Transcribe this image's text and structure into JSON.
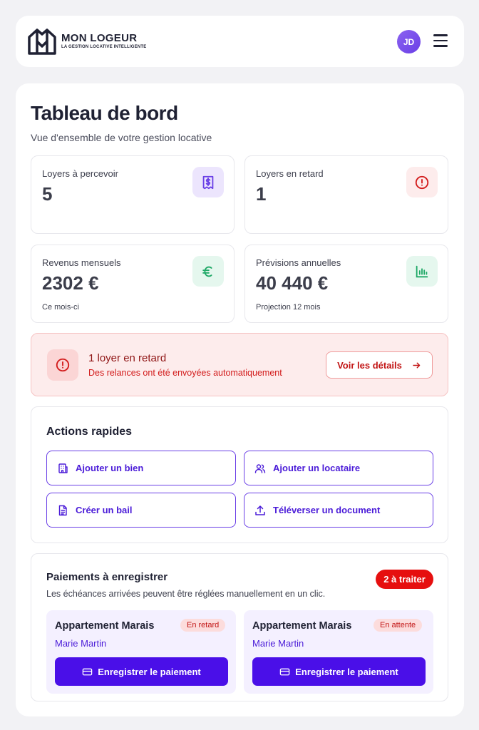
{
  "header": {
    "brand_name": "MON LOGEUR",
    "brand_tagline": "LA GESTION LOCATIVE INTELLIGENTE",
    "avatar_initials": "JD",
    "menu_icon": "hamburger-menu-icon"
  },
  "page": {
    "title": "Tableau de bord",
    "subtitle": "Vue d'ensemble de votre gestion locative"
  },
  "stats": [
    {
      "label": "Loyers à percevoir",
      "value": "5",
      "note": "",
      "icon": "receipt-dollar-icon",
      "icon_color": "#6a3fe6",
      "icon_bg": "#ece5fd"
    },
    {
      "label": "Loyers en retard",
      "value": "1",
      "note": "",
      "icon": "alert-circle-icon",
      "icon_color": "#d21a1a",
      "icon_bg": "#fdecec"
    },
    {
      "label": "Revenus mensuels",
      "value": "2302 €",
      "note": "Ce mois-ci",
      "icon": "euro-icon",
      "icon_color": "#1fa866",
      "icon_bg": "#e5f7ee"
    },
    {
      "label": "Prévisions annuelles",
      "value": "40 440 €",
      "note": "Projection 12 mois",
      "icon": "bar-chart-icon",
      "icon_color": "#1fa866",
      "icon_bg": "#e5f7ee"
    }
  ],
  "alert": {
    "title": "1 loyer en retard",
    "description": "Des relances ont été envoyées automatiquement",
    "button_label": "Voir les détails"
  },
  "quick_actions": {
    "title": "Actions rapides",
    "items": [
      {
        "label": "Ajouter un bien",
        "icon": "building-icon"
      },
      {
        "label": "Ajouter un locataire",
        "icon": "users-icon"
      },
      {
        "label": "Créer un bail",
        "icon": "document-icon"
      },
      {
        "label": "Téléverser un document",
        "icon": "upload-icon"
      }
    ]
  },
  "payments": {
    "title": "Paiements à enregistrer",
    "description": "Les échéances arrivées peuvent être réglées manuellement en un clic.",
    "badge": "2 à traiter",
    "cards": [
      {
        "property": "Appartement Marais",
        "status": "En retard",
        "tenant": "Marie Martin",
        "button_label": "Enregistrer le paiement"
      },
      {
        "property": "Appartement Marais",
        "status": "En attente",
        "tenant": "Marie Martin",
        "button_label": "Enregistrer le paiement"
      }
    ]
  },
  "colors": {
    "accent": "#4a0fe8",
    "danger": "#e60f0f",
    "success": "#1fa866"
  }
}
